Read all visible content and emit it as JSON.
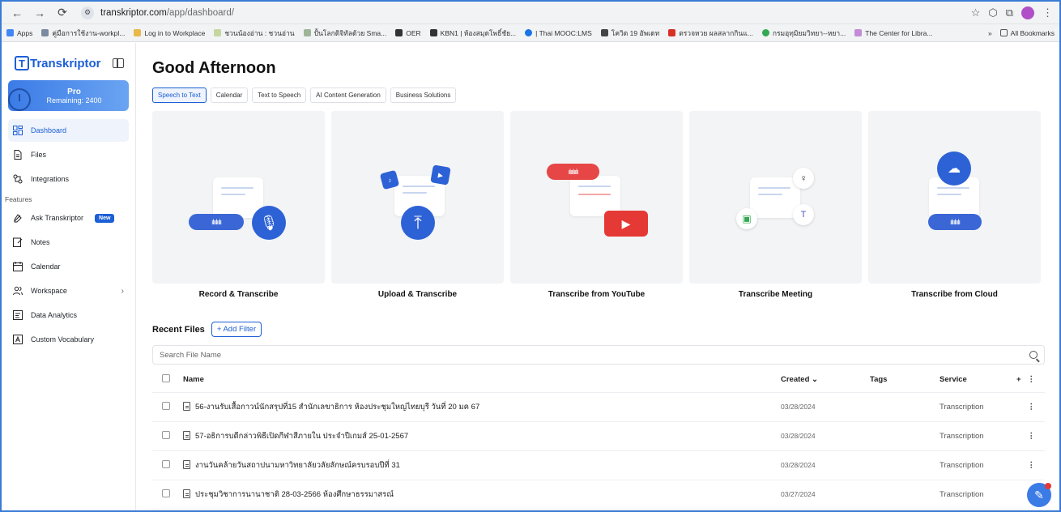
{
  "browser": {
    "url_host": "transkriptor.com",
    "url_path": "/app/dashboard/",
    "bookmarks": [
      "Apps",
      "คู่มือการใช้งาน-workpl...",
      "Log in to Workplace",
      "ชวนน้องอ่าน : ชวนอ่าน",
      "ปั้นโลกดิจิทัลด้วย Sma...",
      "OER",
      "KBN1 | ห้องสมุดโพธิ์ชัย...",
      "| Thai MOOC:LMS",
      "โควิด 19 อัพเดท",
      "ตรวจหวย ผลสลากกินแ...",
      "กรมอุทุมิยมวิทยา--หยา...",
      "The Center for Libra..."
    ],
    "more": "»",
    "all_bookmarks": "All Bookmarks"
  },
  "sidebar": {
    "brand": "Transkriptor",
    "brand_mark": "T",
    "pro_title": "Pro",
    "pro_remaining": "Remaining: 2400",
    "items": [
      {
        "label": "Dashboard"
      },
      {
        "label": "Files"
      },
      {
        "label": "Integrations"
      }
    ],
    "features_label": "Features",
    "features": [
      {
        "label": "Ask Transkriptor",
        "badge": "New"
      },
      {
        "label": "Notes"
      },
      {
        "label": "Calendar"
      },
      {
        "label": "Workspace"
      },
      {
        "label": "Data Analytics"
      },
      {
        "label": "Custom Vocabulary"
      }
    ]
  },
  "main": {
    "greeting": "Good Afternoon",
    "tabs": [
      "Speech to Text",
      "Calendar",
      "Text to Speech",
      "AI Content Generation",
      "Business Solutions"
    ],
    "cards": [
      {
        "label": "Record & Transcribe"
      },
      {
        "label": "Upload & Transcribe"
      },
      {
        "label": "Transcribe from YouTube"
      },
      {
        "label": "Transcribe Meeting"
      },
      {
        "label": "Transcribe from Cloud"
      }
    ],
    "recent_title": "Recent Files",
    "add_filter": "+ Add Filter",
    "search_placeholder": "Search File Name",
    "columns": {
      "name": "Name",
      "created": "Created ⌄",
      "tags": "Tags",
      "service": "Service",
      "add": "+"
    },
    "rows": [
      {
        "name": "56-งานรับเสื้อกาวน์นักสรุปที่15 สำนักเลขาธิการ ห้องประชุมใหญ่ไทยบุรี วันที่ 20 มค 67",
        "created": "03/28/2024",
        "service": "Transcription"
      },
      {
        "name": "57-อธิการบดีกล่าวพิธีเปิดกีฬาสีภายใน ประจำปีเกมส์ 25-01-2567",
        "created": "03/28/2024",
        "service": "Transcription"
      },
      {
        "name": "งานวันคล้ายวันสถาปนามหาวิทยาลัยวลัยลักษณ์ครบรอบปีที่ 31",
        "created": "03/28/2024",
        "service": "Transcription"
      },
      {
        "name": "ประชุมวิชาการนานาชาติ 28-03-2566 ห้องศึกษาธรรมาสรณ์",
        "created": "03/27/2024",
        "service": "Transcription"
      }
    ]
  },
  "colors": {
    "brand": "#1c5fd6",
    "youtube": "#e53935",
    "accent_red": "#e64646"
  }
}
